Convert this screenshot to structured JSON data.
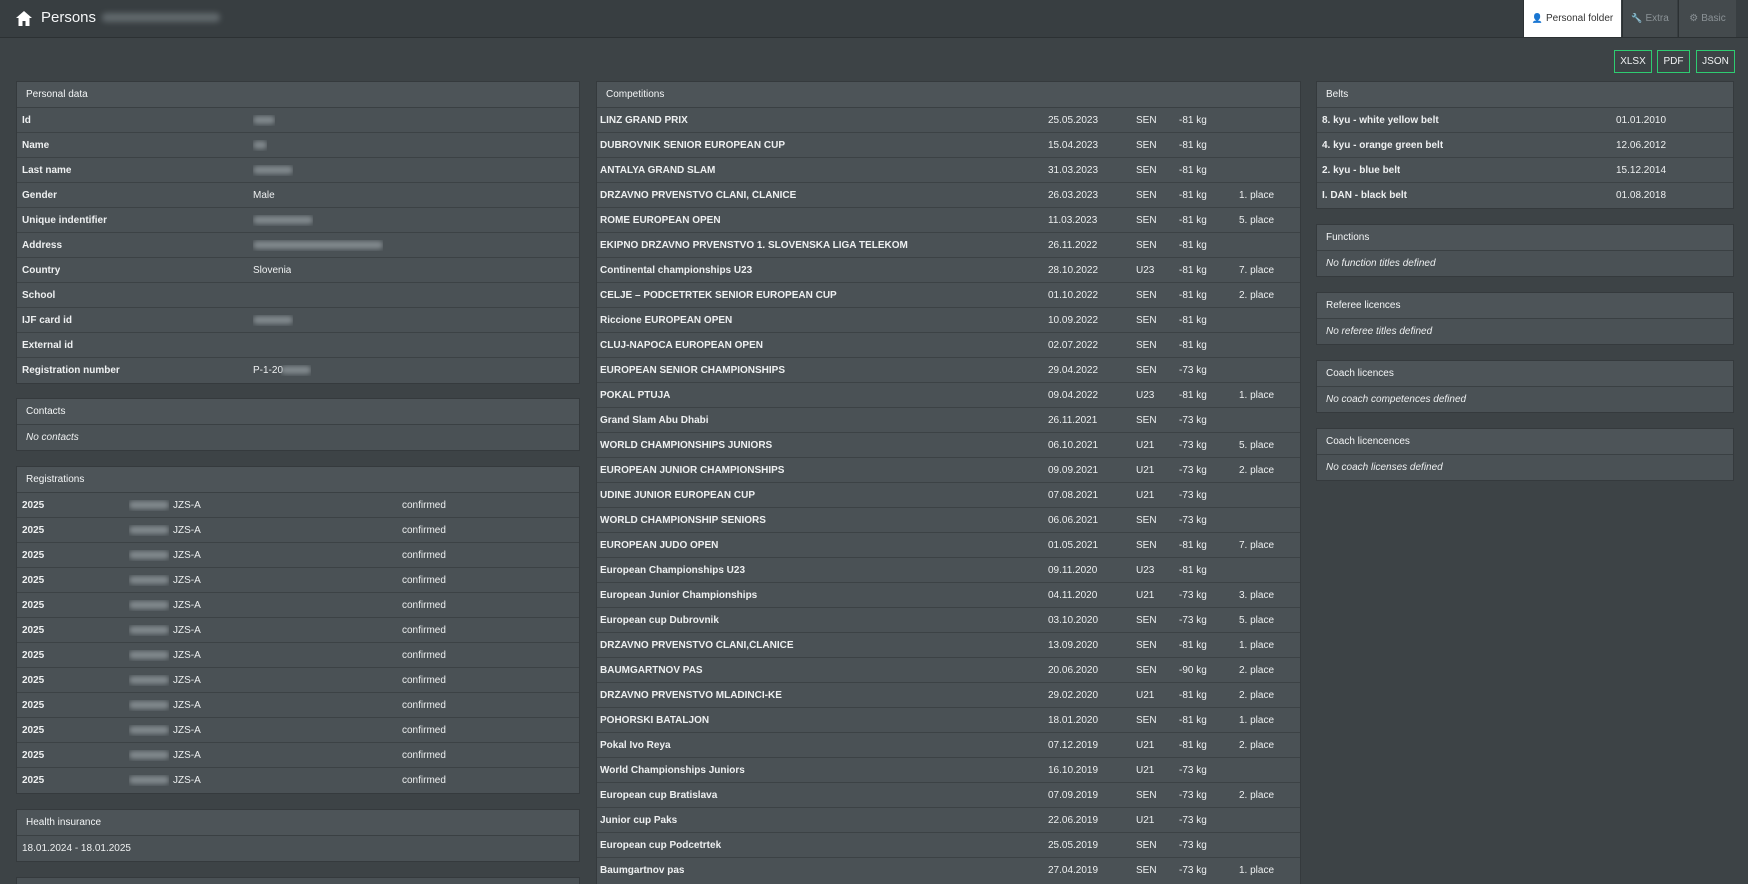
{
  "header": {
    "title": "Persons"
  },
  "tabs": [
    {
      "label": "Personal folder",
      "icon": "person-icon"
    },
    {
      "label": "Extra",
      "icon": "wrench-icon"
    },
    {
      "label": "Basic",
      "icon": "gear-icon"
    }
  ],
  "exports": {
    "xlsx": "XLSX",
    "pdf": "PDF",
    "json": "JSON"
  },
  "personal": {
    "title": "Personal data",
    "rows": [
      {
        "label": "Id",
        "value": ""
      },
      {
        "label": "Name",
        "value": ""
      },
      {
        "label": "Last name",
        "value": ""
      },
      {
        "label": "Gender",
        "value": "Male"
      },
      {
        "label": "Unique indentifier",
        "value": ""
      },
      {
        "label": "Address",
        "value": ""
      },
      {
        "label": "Country",
        "value": "Slovenia"
      },
      {
        "label": "School",
        "value": ""
      },
      {
        "label": "IJF card id",
        "value": ""
      },
      {
        "label": "External id",
        "value": ""
      },
      {
        "label": "Registration number",
        "value": "P-1-20"
      }
    ]
  },
  "contacts": {
    "title": "Contacts",
    "empty": "No contacts"
  },
  "registrations": {
    "title": "Registrations",
    "rows": [
      {
        "year": "2025",
        "club": "JZS-A",
        "status": "confirmed"
      },
      {
        "year": "2025",
        "club": "JZS-A",
        "status": "confirmed"
      },
      {
        "year": "2025",
        "club": "JZS-A",
        "status": "confirmed"
      },
      {
        "year": "2025",
        "club": "JZS-A",
        "status": "confirmed"
      },
      {
        "year": "2025",
        "club": "JZS-A",
        "status": "confirmed"
      },
      {
        "year": "2025",
        "club": "JZS-A",
        "status": "confirmed"
      },
      {
        "year": "2025",
        "club": "JZS-A",
        "status": "confirmed"
      },
      {
        "year": "2025",
        "club": "JZS-A",
        "status": "confirmed"
      },
      {
        "year": "2025",
        "club": "JZS-A",
        "status": "confirmed"
      },
      {
        "year": "2025",
        "club": "JZS-A",
        "status": "confirmed"
      },
      {
        "year": "2025",
        "club": "JZS-A",
        "status": "confirmed"
      },
      {
        "year": "2025",
        "club": "JZS-A",
        "status": "confirmed"
      }
    ]
  },
  "health": {
    "title": "Health insurance",
    "value": "18.01.2024 - 18.01.2025"
  },
  "competitions": {
    "title": "Competitions",
    "rows": [
      {
        "name": "LINZ GRAND PRIX",
        "date": "25.05.2023",
        "age": "SEN",
        "weight": "-81 kg",
        "place": ""
      },
      {
        "name": "DUBROVNIK SENIOR EUROPEAN CUP",
        "date": "15.04.2023",
        "age": "SEN",
        "weight": "-81 kg",
        "place": ""
      },
      {
        "name": "ANTALYA GRAND SLAM",
        "date": "31.03.2023",
        "age": "SEN",
        "weight": "-81 kg",
        "place": ""
      },
      {
        "name": "DRŽAVNO PRVENSTVO ČLANI, ČLANICE",
        "date": "26.03.2023",
        "age": "SEN",
        "weight": "-81 kg",
        "place": "1. place"
      },
      {
        "name": "ROME EUROPEAN OPEN",
        "date": "11.03.2023",
        "age": "SEN",
        "weight": "-81 kg",
        "place": "5. place"
      },
      {
        "name": "EKIPNO DRŽAVNO PRVENSTVO 1. SLOVENSKA LIGA TELEKOM",
        "date": "26.11.2022",
        "age": "SEN",
        "weight": "-81 kg",
        "place": ""
      },
      {
        "name": "Continental championships U23",
        "date": "28.10.2022",
        "age": "U23",
        "weight": "-81 kg",
        "place": "7. place"
      },
      {
        "name": "CELJE – PODCETRTEK SENIOR EUROPEAN CUP",
        "date": "01.10.2022",
        "age": "SEN",
        "weight": "-81 kg",
        "place": "2. place"
      },
      {
        "name": "Riccione EUROPEAN OPEN",
        "date": "10.09.2022",
        "age": "SEN",
        "weight": "-81 kg",
        "place": ""
      },
      {
        "name": "CLUJ-NAPOCA EUROPEAN OPEN",
        "date": "02.07.2022",
        "age": "SEN",
        "weight": "-81 kg",
        "place": ""
      },
      {
        "name": "EUROPEAN SENIOR CHAMPIONSHIPS",
        "date": "29.04.2022",
        "age": "SEN",
        "weight": "-73 kg",
        "place": ""
      },
      {
        "name": "POKAL PTUJA",
        "date": "09.04.2022",
        "age": "U23",
        "weight": "-81 kg",
        "place": "1. place"
      },
      {
        "name": "Grand Slam Abu Dhabi",
        "date": "26.11.2021",
        "age": "SEN",
        "weight": "-73 kg",
        "place": ""
      },
      {
        "name": "WORLD CHAMPIONSHIPS JUNIORS",
        "date": "06.10.2021",
        "age": "U21",
        "weight": "-73 kg",
        "place": "5. place"
      },
      {
        "name": "EUROPEAN JUNIOR CHAMPIONSHIPS",
        "date": "09.09.2021",
        "age": "U21",
        "weight": "-73 kg",
        "place": "2. place"
      },
      {
        "name": "UDINE JUNIOR EUROPEAN CUP",
        "date": "07.08.2021",
        "age": "U21",
        "weight": "-73 kg",
        "place": ""
      },
      {
        "name": "WORLD CHAMPIONSHIP SENIORS",
        "date": "06.06.2021",
        "age": "SEN",
        "weight": "-73 kg",
        "place": ""
      },
      {
        "name": "EUROPEAN JUDO OPEN",
        "date": "01.05.2021",
        "age": "SEN",
        "weight": "-81 kg",
        "place": "7. place"
      },
      {
        "name": "European Championships U23",
        "date": "09.11.2020",
        "age": "U23",
        "weight": "-81 kg",
        "place": ""
      },
      {
        "name": "European Junior Championships",
        "date": "04.11.2020",
        "age": "U21",
        "weight": "-73 kg",
        "place": "3. place"
      },
      {
        "name": "European cup Dubrovnik",
        "date": "03.10.2020",
        "age": "SEN",
        "weight": "-73 kg",
        "place": "5. place"
      },
      {
        "name": "DRŽAVNO PRVENSTVO ČLANI,ČLANICE",
        "date": "13.09.2020",
        "age": "SEN",
        "weight": "-81 kg",
        "place": "1. place"
      },
      {
        "name": "BAUMGARTNOV PAS",
        "date": "20.06.2020",
        "age": "SEN",
        "weight": "-90 kg",
        "place": "2. place"
      },
      {
        "name": "DRŽAVNO PRVENSTVO MLADINCI-KE",
        "date": "29.02.2020",
        "age": "U21",
        "weight": "-81 kg",
        "place": "2. place"
      },
      {
        "name": "POHORSKI BATALJON",
        "date": "18.01.2020",
        "age": "SEN",
        "weight": "-81 kg",
        "place": "1. place"
      },
      {
        "name": "Pokal Ivo Reya",
        "date": "07.12.2019",
        "age": "U21",
        "weight": "-81 kg",
        "place": "2. place"
      },
      {
        "name": "World Championships Juniors",
        "date": "16.10.2019",
        "age": "U21",
        "weight": "-73 kg",
        "place": ""
      },
      {
        "name": "European cup Bratislava",
        "date": "07.09.2019",
        "age": "SEN",
        "weight": "-73 kg",
        "place": "2. place"
      },
      {
        "name": "Junior cup Paks",
        "date": "22.06.2019",
        "age": "U21",
        "weight": "-73 kg",
        "place": ""
      },
      {
        "name": "European cup Podcetrtek",
        "date": "25.05.2019",
        "age": "SEN",
        "weight": "-73 kg",
        "place": ""
      },
      {
        "name": "Baumgartnov pas",
        "date": "27.04.2019",
        "age": "SEN",
        "weight": "-73 kg",
        "place": "1. place"
      }
    ]
  },
  "belts": {
    "title": "Belts",
    "rows": [
      {
        "name": "8. kyu - white yellow belt",
        "date": "01.01.2010"
      },
      {
        "name": "4. kyu - orange green belt",
        "date": "12.06.2012"
      },
      {
        "name": "2. kyu - blue belt",
        "date": "15.12.2014"
      },
      {
        "name": "I. DAN - black belt",
        "date": "01.08.2018"
      }
    ]
  },
  "functions": {
    "title": "Functions",
    "empty": "No function titles defined"
  },
  "referee": {
    "title": "Referee licences",
    "empty": "No referee titles defined"
  },
  "coach": {
    "title": "Coach licences",
    "empty": "No coach competences defined"
  },
  "coach2": {
    "title": "Coach licencences",
    "empty": "No coach licenses defined"
  },
  "colors": {
    "accent": "#2ecc71",
    "background": "#3d4346",
    "panel": "#4a5155"
  }
}
